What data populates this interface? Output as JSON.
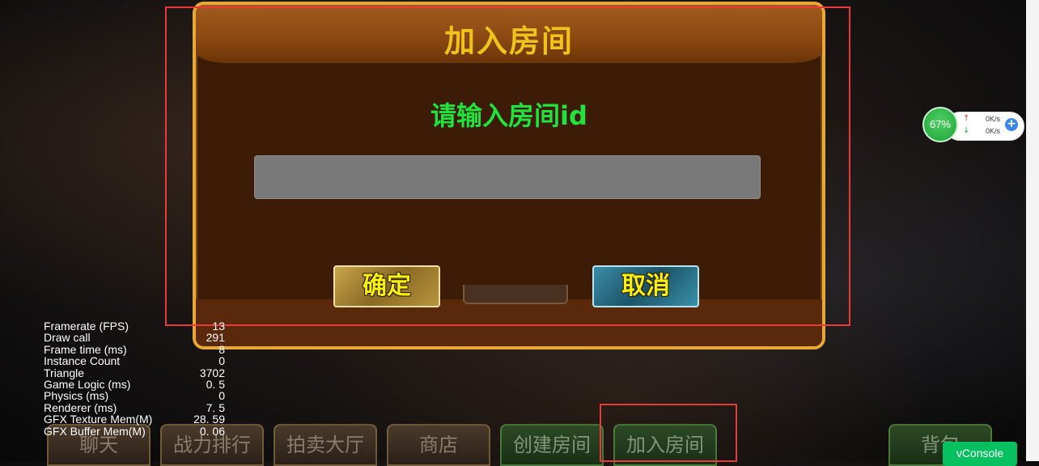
{
  "dialog": {
    "title": "加入房间",
    "prompt": "请输入房间id",
    "input_value": "",
    "confirm_label": "确定",
    "cancel_label": "取消"
  },
  "bottom_tabs": [
    {
      "label": "聊天"
    },
    {
      "label": "战力排行"
    },
    {
      "label": "拍卖大厅"
    },
    {
      "label": "商店"
    },
    {
      "label": "创建房间"
    },
    {
      "label": "加入房间"
    },
    {
      "label": "背包"
    }
  ],
  "stats": [
    {
      "label": "Framerate (FPS)",
      "value": "13"
    },
    {
      "label": "Draw call",
      "value": "291"
    },
    {
      "label": "Frame time (ms)",
      "value": "8"
    },
    {
      "label": "Instance Count",
      "value": "0"
    },
    {
      "label": "Triangle",
      "value": "3702"
    },
    {
      "label": "Game Logic (ms)",
      "value": "0. 5"
    },
    {
      "label": "Physics (ms)",
      "value": "0"
    },
    {
      "label": "Renderer (ms)",
      "value": "7. 5"
    },
    {
      "label": "GFX Texture Mem(M)",
      "value": "28. 59"
    },
    {
      "label": "GFX Buffer Mem(M)",
      "value": "0. 06"
    }
  ],
  "network": {
    "percent": "67%",
    "upload": "0K/s",
    "download": "0K/s"
  },
  "vconsole_label": "vConsole",
  "colors": {
    "dialog_border": "#e8a838",
    "title": "#f0c21c",
    "prompt": "#22e23c",
    "annotation": "#e83a3a",
    "vconsole": "#07c160"
  }
}
